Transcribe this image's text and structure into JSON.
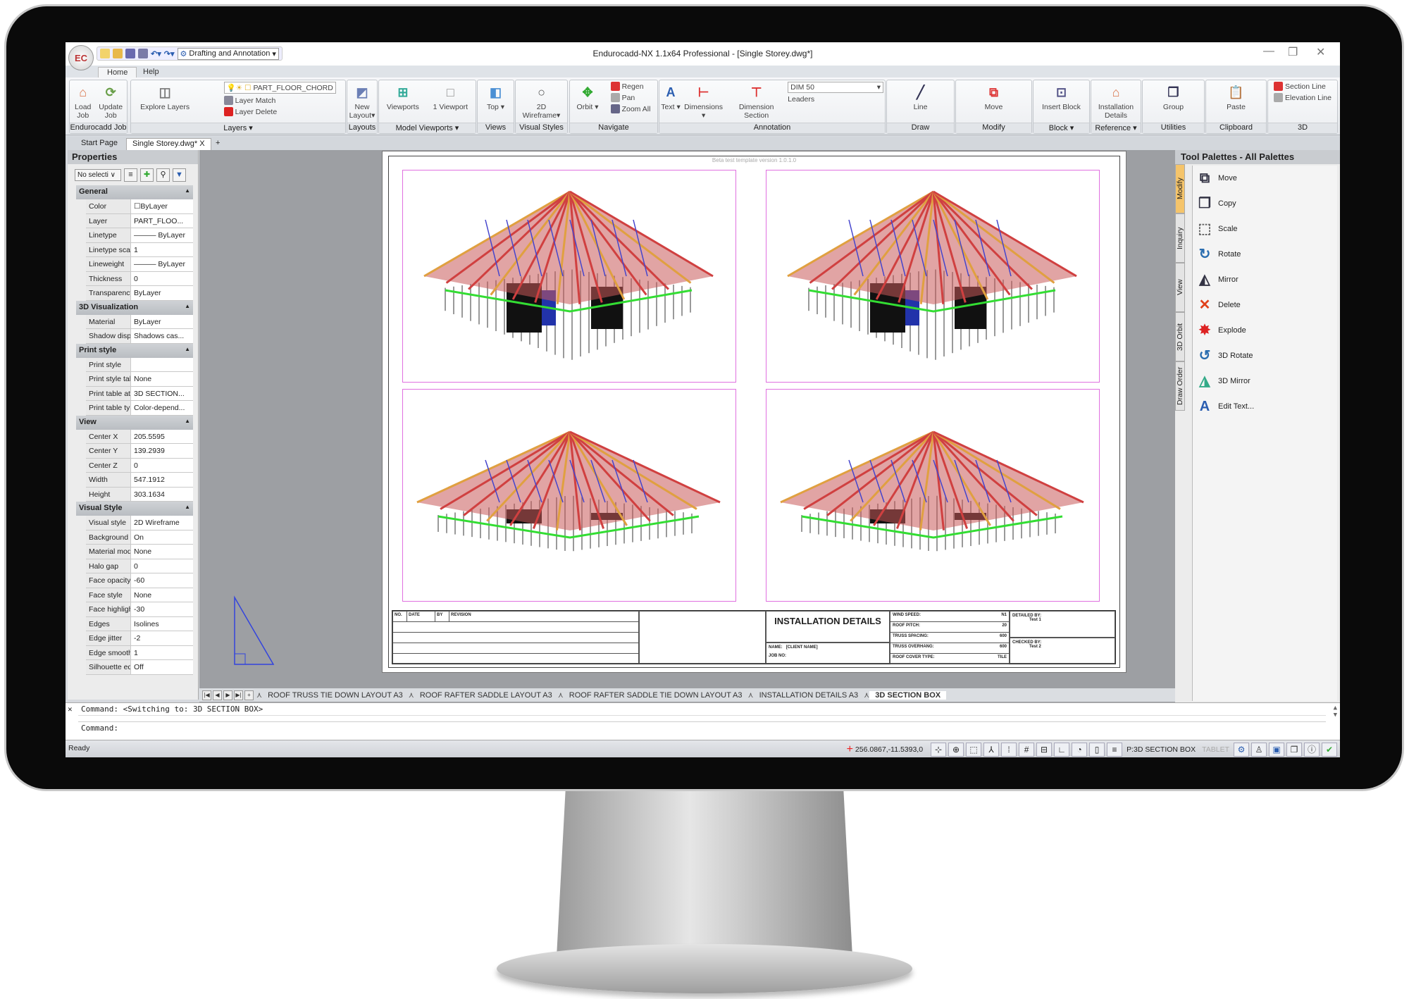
{
  "app": {
    "title": "Endurocadd-NX 1.1x64 Professional  - [Single Storey.dwg*]",
    "logo": "EC",
    "workspace": "Drafting and Annotation",
    "minimize": "—",
    "restore": "❐",
    "close": "✕"
  },
  "menu_tabs": [
    "Home",
    "Help"
  ],
  "ribbon": [
    {
      "label": "Endurocadd Job",
      "buttons": [
        {
          "label": "Load Job",
          "icon": "house-icon",
          "color": "#d9744a"
        },
        {
          "label": "Update Job",
          "icon": "house-update-icon",
          "color": "#6a9f4a"
        }
      ]
    },
    {
      "label": "Layers ▾",
      "buttons": [
        {
          "label": "Explore Layers",
          "icon": "layers-icon",
          "color": "#777"
        }
      ],
      "layer": "PART_FLOOR_CHORD",
      "small": [
        "Layer Match",
        "Layer Delete"
      ]
    },
    {
      "label": "Layouts",
      "buttons": [
        {
          "label": "New Layout▾",
          "icon": "layout-icon",
          "color": "#6b7fb5"
        }
      ]
    },
    {
      "label": "Model Viewports ▾",
      "buttons": [
        {
          "label": "Viewports",
          "icon": "viewports-icon",
          "color": "#3a9"
        },
        {
          "label": "1 Viewport",
          "icon": "viewport-icon",
          "color": "#888"
        }
      ]
    },
    {
      "label": "Views",
      "buttons": [
        {
          "label": "Top ▾",
          "icon": "cube-icon",
          "color": "#4a8fd4"
        }
      ]
    },
    {
      "label": "Visual Styles",
      "buttons": [
        {
          "label": "2D Wireframe▾",
          "icon": "sphere-icon",
          "color": "#555"
        }
      ]
    },
    {
      "label": "Navigate",
      "buttons": [
        {
          "label": "Orbit ▾",
          "icon": "orbit-icon",
          "color": "#3a3"
        }
      ],
      "small": [
        "Regen",
        "Pan",
        "Zoom All"
      ]
    },
    {
      "label": "Annotation",
      "buttons": [
        {
          "label": "Text ▾",
          "icon": "text-icon",
          "color": "#2a5db0"
        },
        {
          "label": "Dimensions ▾",
          "icon": "dimension-icon",
          "color": "#d33"
        },
        {
          "label": "Dimension Section",
          "icon": "dimension-section-icon",
          "color": "#d33"
        }
      ],
      "dim_style": "DIM 50",
      "small": [
        "Leaders"
      ]
    },
    {
      "label": "Draw",
      "buttons": [
        {
          "label": "Line",
          "icon": "line-icon",
          "color": "#335"
        }
      ]
    },
    {
      "label": "Modify",
      "buttons": [
        {
          "label": "Move",
          "icon": "move-icon",
          "color": "#d33"
        }
      ]
    },
    {
      "label": "Block ▾",
      "buttons": [
        {
          "label": "Insert Block",
          "icon": "insert-block-icon",
          "color": "#558"
        }
      ]
    },
    {
      "label": "Reference ▾",
      "buttons": [
        {
          "label": "Installation Details",
          "icon": "installation-icon",
          "color": "#d9744a"
        }
      ]
    },
    {
      "label": "Utilities",
      "buttons": [
        {
          "label": "Group",
          "icon": "group-icon",
          "color": "#335"
        }
      ]
    },
    {
      "label": "Clipboard",
      "buttons": [
        {
          "label": "Paste",
          "icon": "paste-icon",
          "color": "#e0a030"
        }
      ]
    },
    {
      "label": "3D",
      "buttons": [],
      "small": [
        "Section Line",
        "Elevation Line"
      ]
    }
  ],
  "doc_tabs": {
    "start": "Start Page",
    "active": "Single Storey.dwg*",
    "close": "X",
    "add": "+"
  },
  "properties": {
    "title": "Properties",
    "selection": "No selecti ∨",
    "sections": [
      {
        "name": "General",
        "rows": [
          [
            "Color",
            "☐ByLayer"
          ],
          [
            "Layer",
            "PART_FLOO..."
          ],
          [
            "Linetype",
            "——— ByLayer"
          ],
          [
            "Linetype scale",
            "1"
          ],
          [
            "Lineweight",
            "——— ByLayer"
          ],
          [
            "Thickness",
            "0"
          ],
          [
            "Transparency",
            "ByLayer"
          ]
        ]
      },
      {
        "name": "3D Visualization",
        "rows": [
          [
            "Material",
            "ByLayer"
          ],
          [
            "Shadow displ...",
            "Shadows cas..."
          ]
        ]
      },
      {
        "name": "Print style",
        "rows": [
          [
            "Print style",
            ""
          ],
          [
            "Print style table",
            "None"
          ],
          [
            "Print table att...",
            "3D SECTION..."
          ],
          [
            "Print table type",
            "Color-depend..."
          ]
        ]
      },
      {
        "name": "View",
        "rows": [
          [
            "Center X",
            "205.5595"
          ],
          [
            "Center Y",
            "139.2939"
          ],
          [
            "Center Z",
            "0"
          ],
          [
            "Width",
            "547.1912"
          ],
          [
            "Height",
            "303.1634"
          ]
        ]
      },
      {
        "name": "Visual Style",
        "rows": [
          [
            "Visual style",
            "2D Wireframe"
          ],
          [
            "Background",
            "On"
          ],
          [
            "Material mode",
            "None"
          ],
          [
            "Halo gap",
            "0"
          ],
          [
            "Face opacity",
            "-60"
          ],
          [
            "Face style",
            "None"
          ],
          [
            "Face highlight",
            "-30"
          ],
          [
            "Edges",
            "Isolines"
          ],
          [
            "Edge jitter",
            "-2"
          ],
          [
            "Edge smoothi...",
            "1"
          ],
          [
            "Silhouette ed...",
            "Off"
          ]
        ]
      }
    ]
  },
  "drawing": {
    "template_note": "Beta test template version 1.0.1.0",
    "title_block": {
      "revision_headers": [
        "NO.",
        "DATE",
        "BY",
        "REVISION"
      ],
      "title": "INSTALLATION DETAILS",
      "name_label": "NAME:",
      "name_value": "[CLIENT NAME]",
      "job_label": "JOB NO:",
      "specs": [
        [
          "WIND SPEED:",
          "N1"
        ],
        [
          "ROOF PITCH:",
          "20"
        ],
        [
          "TRUSS SPACING:",
          "600"
        ],
        [
          "TRUSS OVERHANG:",
          "600"
        ],
        [
          "ROOF COVER TYPE:",
          "TILE"
        ]
      ],
      "detailed_by_label": "DETAILED BY:",
      "detailed_by": "Test 1",
      "checked_by_label": "CHECKED BY:",
      "checked_by": "Test 2"
    }
  },
  "layout_tabs": [
    "ROOF TRUSS TIE DOWN LAYOUT A3",
    "ROOF RAFTER SADDLE LAYOUT A3",
    "ROOF RAFTER SADDLE TIE DOWN LAYOUT A3",
    "INSTALLATION DETAILS A3",
    "3D SECTION BOX"
  ],
  "active_layout": "3D SECTION BOX",
  "tool_palettes": {
    "title": "Tool Palettes - All Palettes",
    "tabs": [
      "Modify",
      "Inquiry",
      "View",
      "3D Orbit",
      "Draw Order"
    ],
    "items": [
      {
        "label": "Move",
        "icon": "move-icon",
        "glyph": "⧉",
        "color": "#334"
      },
      {
        "label": "Copy",
        "icon": "copy-icon",
        "glyph": "❐",
        "color": "#334"
      },
      {
        "label": "Scale",
        "icon": "scale-icon",
        "glyph": "⬚",
        "color": "#666"
      },
      {
        "label": "Rotate",
        "icon": "rotate-icon",
        "glyph": "↻",
        "color": "#2a6db0"
      },
      {
        "label": "Mirror",
        "icon": "mirror-icon",
        "glyph": "◭",
        "color": "#334"
      },
      {
        "label": "Delete",
        "icon": "delete-icon",
        "glyph": "✕",
        "color": "#e0401a"
      },
      {
        "label": "Explode",
        "icon": "explode-icon",
        "glyph": "✸",
        "color": "#d22"
      },
      {
        "label": "3D Rotate",
        "icon": "3d-rotate-icon",
        "glyph": "↺",
        "color": "#2a6db0"
      },
      {
        "label": "3D Mirror",
        "icon": "3d-mirror-icon",
        "glyph": "◮",
        "color": "#3a8"
      },
      {
        "label": "Edit Text...",
        "icon": "edit-text-icon",
        "glyph": "A",
        "color": "#2a5db0"
      }
    ]
  },
  "command": {
    "history": "Command: <Switching to: 3D SECTION BOX>",
    "prompt": "Command:"
  },
  "status": {
    "state": "Ready",
    "coords": "256.0867,-11.5393,0",
    "layout": "P:3D SECTION BOX",
    "tablet": "TABLET",
    "icons": [
      "snap-icon",
      "grid-icon",
      "ortho-icon",
      "polar-icon",
      "osnap-icon",
      "otrack-icon",
      "lineweight-icon",
      "dyn-icon",
      "tmode-icon",
      "qp-icon"
    ],
    "tray": [
      "settings-icon",
      "user-icon",
      "workspace-icon",
      "windows-icon",
      "info-icon",
      "ok-icon"
    ]
  }
}
